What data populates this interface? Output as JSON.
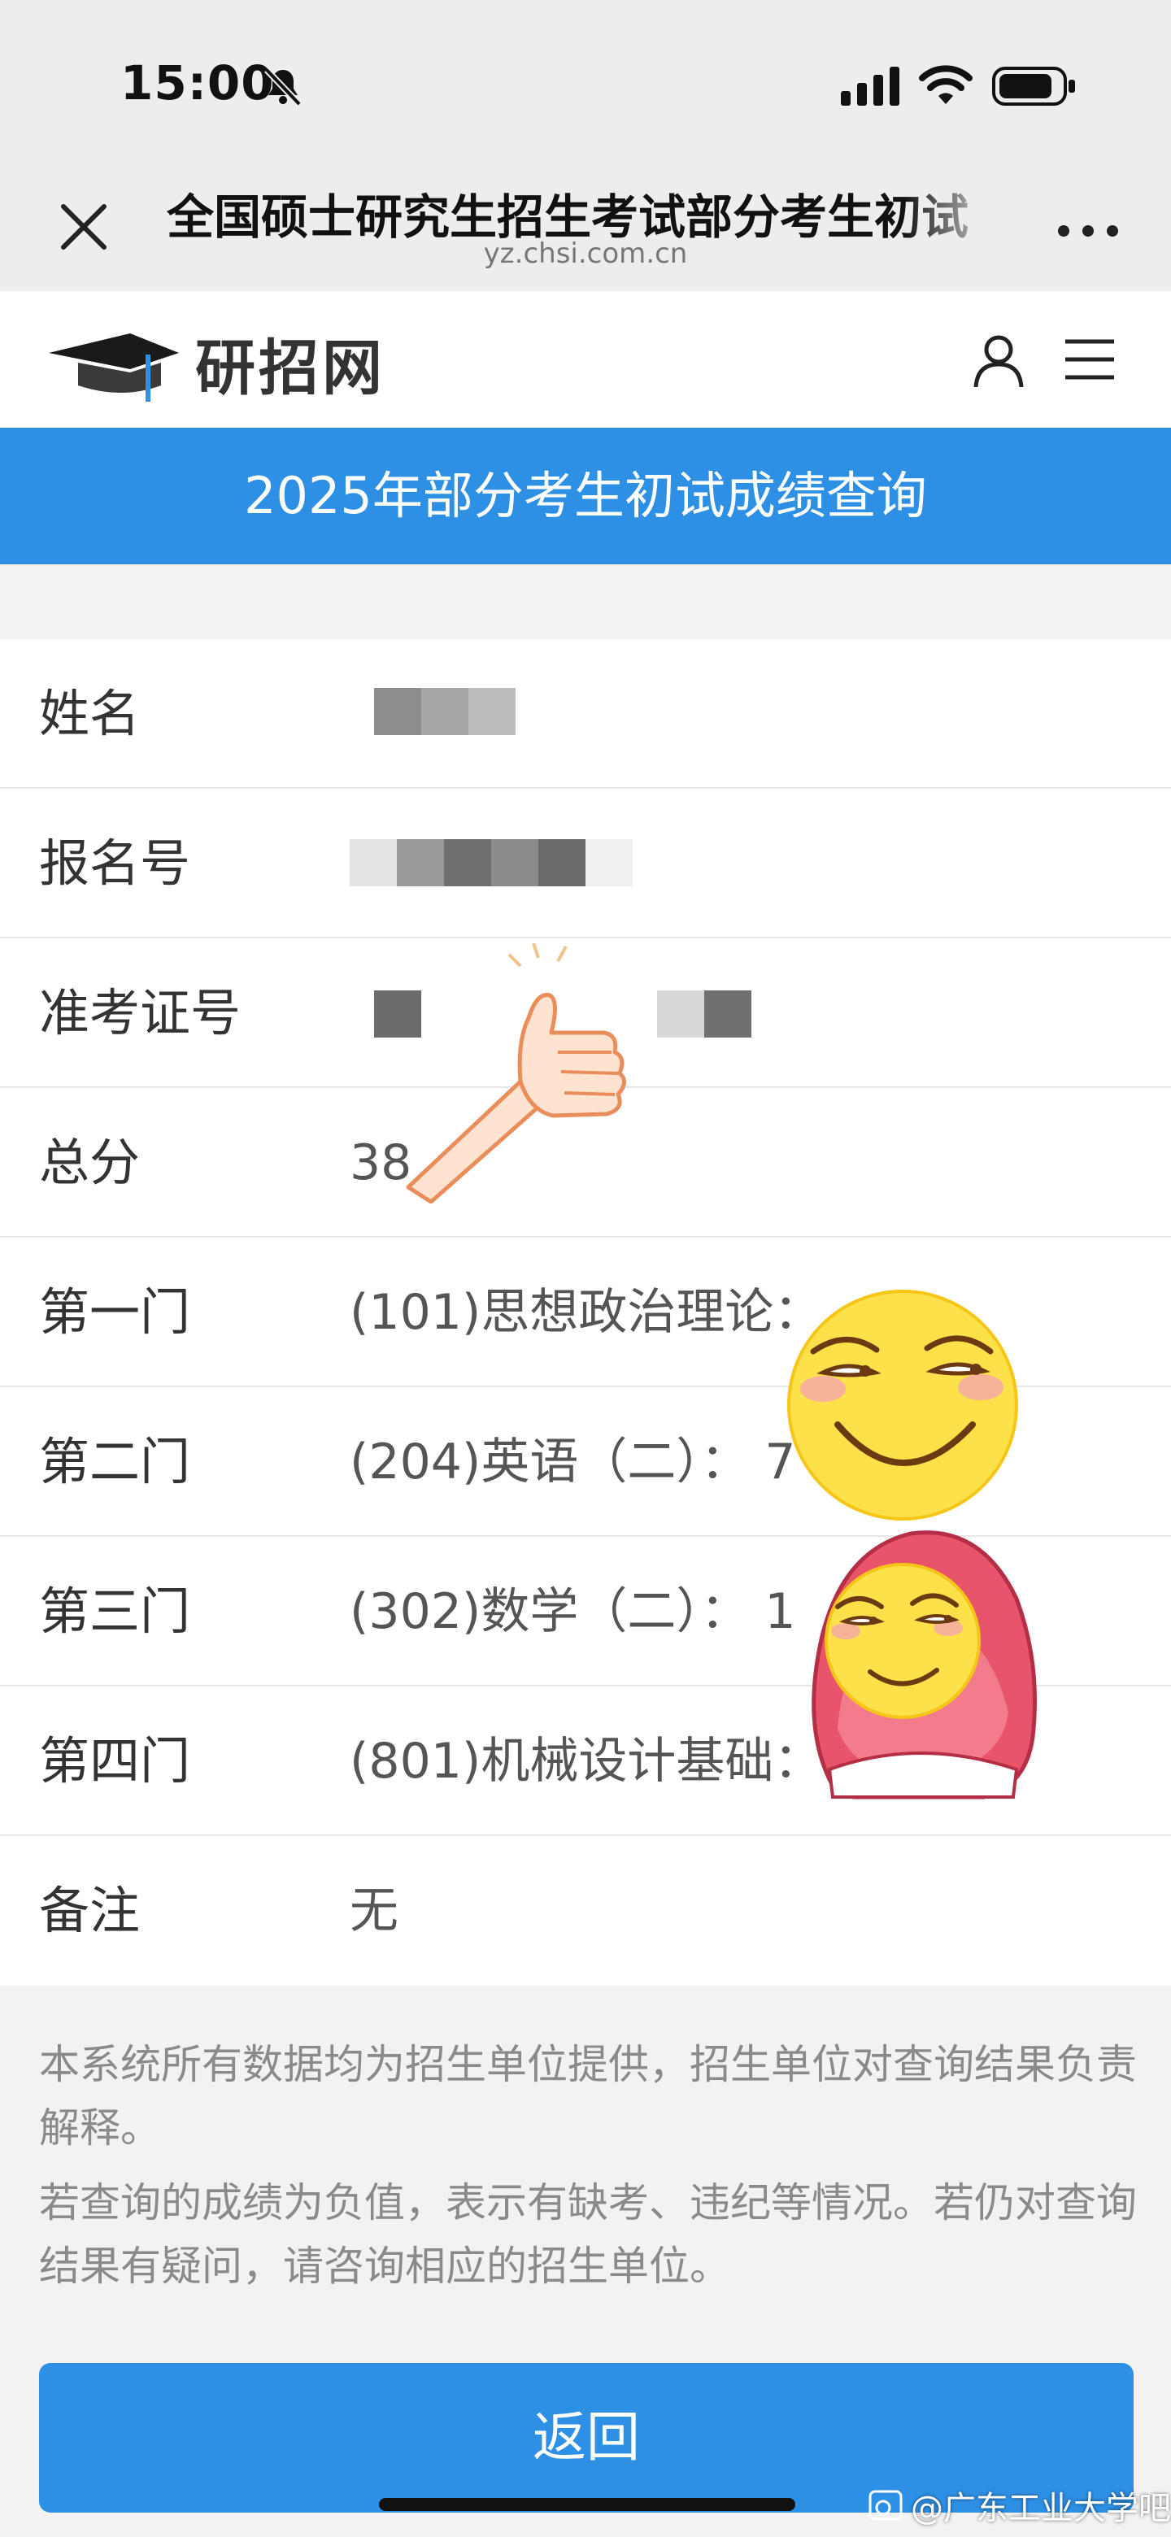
{
  "status_bar": {
    "time": "15:00"
  },
  "browser": {
    "title": "全国硕士研究生招生考试部分考生初试",
    "url": "yz.chsi.com.cn"
  },
  "site": {
    "logo_text": "研招网"
  },
  "page": {
    "heading": "2025年部分考生初试成绩查询"
  },
  "rows": [
    {
      "label": "姓名",
      "value": ""
    },
    {
      "label": "报名号",
      "value": ""
    },
    {
      "label": "准考证号",
      "value": ""
    },
    {
      "label": "总分",
      "value": "38"
    },
    {
      "label": "第一门",
      "value": "(101)思想政治理论："
    },
    {
      "label": "第二门",
      "value": "(204)英语（二）： 7"
    },
    {
      "label": "第三门",
      "value": "(302)数学（二）： 1"
    },
    {
      "label": "第四门",
      "value": "(801)机械设计基础："
    },
    {
      "label": "备注",
      "value": "无"
    }
  ],
  "notes": [
    "本系统所有数据均为招生单位提供，招生单位对查询结果负责解释。",
    "若查询的成绩为负值，表示有缺考、违纪等情况。若仍对查询结果有疑问，请咨询相应的招生单位。"
  ],
  "back_label": "返回",
  "watermark": "@广东工业大学吧",
  "colors": {
    "accent": "#2e90e5",
    "background": "#f2f2f3"
  }
}
